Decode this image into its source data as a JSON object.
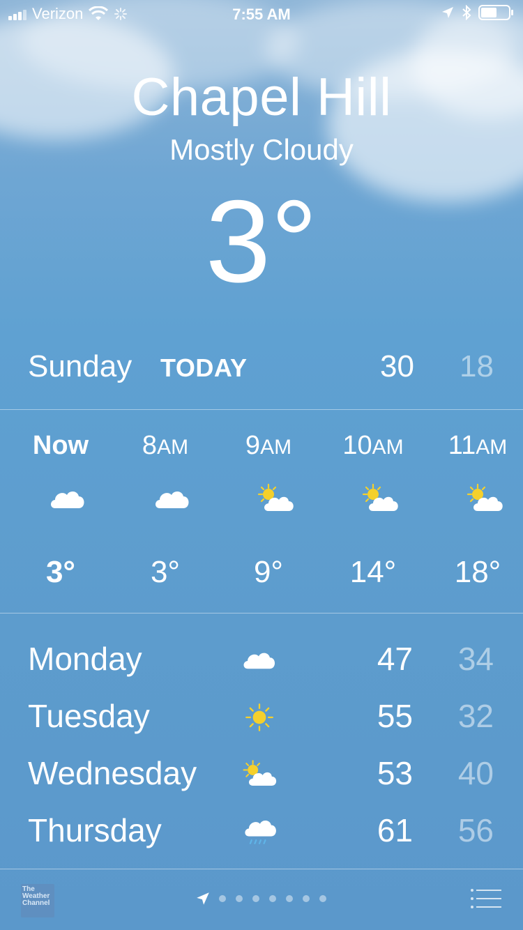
{
  "status_bar": {
    "carrier": "Verizon",
    "time": "7:55 AM"
  },
  "header": {
    "city": "Chapel Hill",
    "condition": "Mostly Cloudy",
    "temperature": "3°"
  },
  "today": {
    "day": "Sunday",
    "label": "TODAY",
    "high": "30",
    "low": "18"
  },
  "hourly": [
    {
      "time": "Now",
      "ampm": "",
      "icon": "cloud-icon",
      "temp": "3°"
    },
    {
      "time": "8",
      "ampm": "AM",
      "icon": "cloud-icon",
      "temp": "3°"
    },
    {
      "time": "9",
      "ampm": "AM",
      "icon": "partly-sunny-icon",
      "temp": "9°"
    },
    {
      "time": "10",
      "ampm": "AM",
      "icon": "partly-sunny-icon",
      "temp": "14°"
    },
    {
      "time": "11",
      "ampm": "AM",
      "icon": "partly-sunny-icon",
      "temp": "18°"
    }
  ],
  "daily": [
    {
      "day": "Monday",
      "icon": "cloud-icon",
      "high": "47",
      "low": "34"
    },
    {
      "day": "Tuesday",
      "icon": "sun-icon",
      "high": "55",
      "low": "32"
    },
    {
      "day": "Wednesday",
      "icon": "partly-sunny-icon",
      "high": "53",
      "low": "40"
    },
    {
      "day": "Thursday",
      "icon": "rain-cloud-icon",
      "high": "61",
      "low": "56"
    }
  ],
  "footer": {
    "logo_text": [
      "The",
      "Weather",
      "Channel"
    ],
    "page_count": 7
  },
  "colors": {
    "sun": "#f5d02b",
    "rain": "#5fb4e8",
    "low_temp": "rgba(255,255,255,0.5)"
  }
}
